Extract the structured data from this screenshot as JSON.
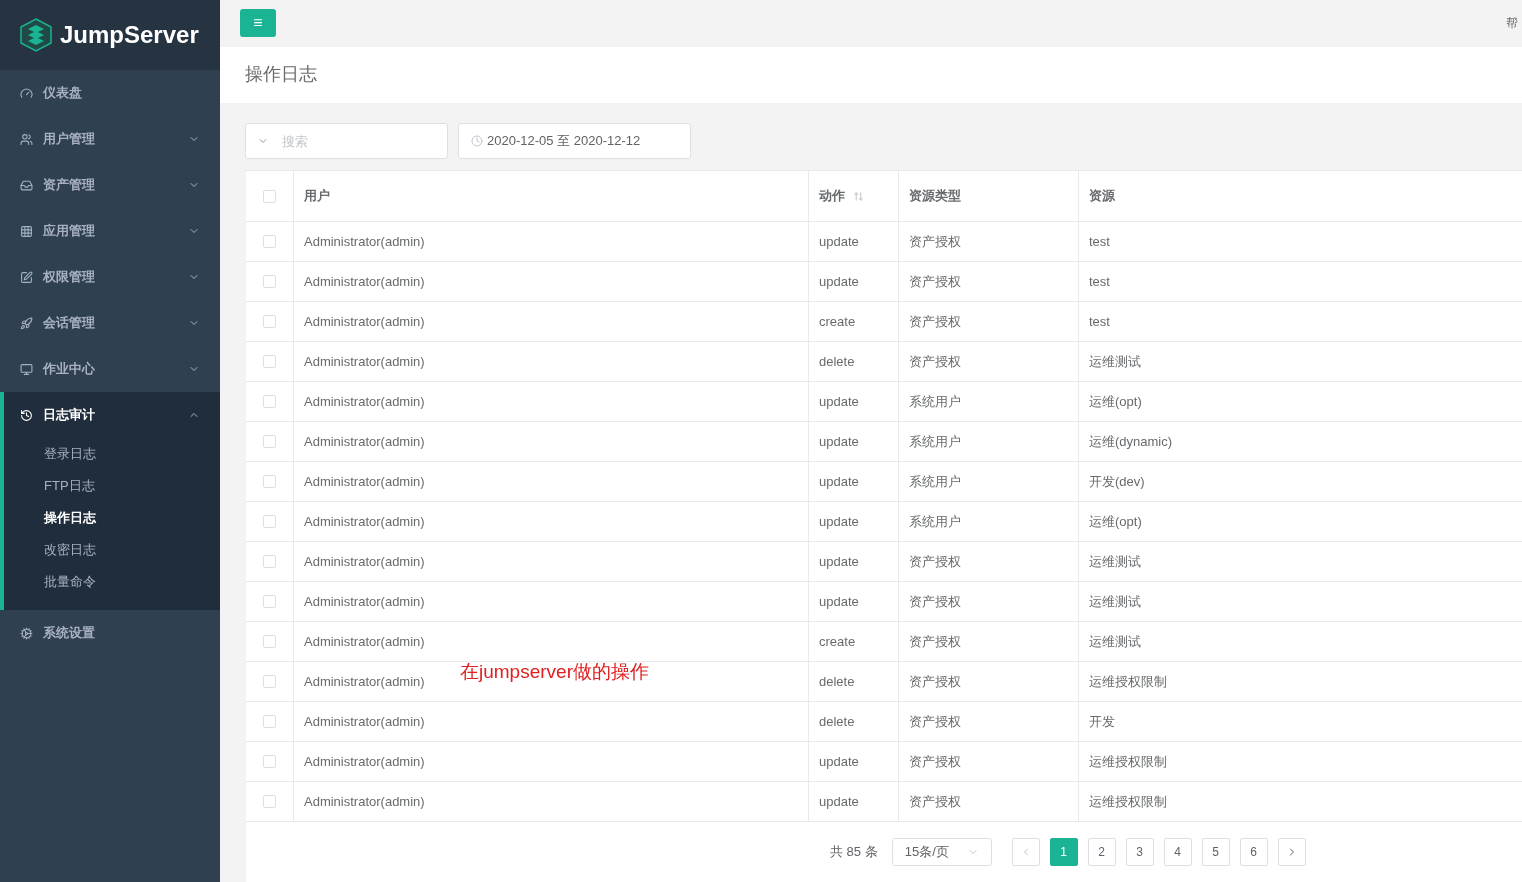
{
  "logo": {
    "text": "JumpServer"
  },
  "sidebar": {
    "items": [
      {
        "kind": "link",
        "label": "仪表盘"
      },
      {
        "kind": "group",
        "label": "用户管理",
        "expanded": false
      },
      {
        "kind": "group",
        "label": "资产管理",
        "expanded": false
      },
      {
        "kind": "group",
        "label": "应用管理",
        "expanded": false
      },
      {
        "kind": "group",
        "label": "权限管理",
        "expanded": false
      },
      {
        "kind": "group",
        "label": "会话管理",
        "expanded": false
      },
      {
        "kind": "group",
        "label": "作业中心",
        "expanded": false
      },
      {
        "kind": "group",
        "label": "日志审计",
        "expanded": true,
        "children": [
          {
            "label": "登录日志",
            "selected": false
          },
          {
            "label": "FTP日志",
            "selected": false
          },
          {
            "label": "操作日志",
            "selected": true
          },
          {
            "label": "改密日志",
            "selected": false
          },
          {
            "label": "批量命令",
            "selected": false
          }
        ]
      },
      {
        "kind": "link",
        "label": "系统设置"
      }
    ]
  },
  "topbar": {
    "menu_button": "≡",
    "help": "帮"
  },
  "page_title": "操作日志",
  "filters": {
    "search": {
      "placeholder": "搜索"
    },
    "date_range": {
      "start": "2020-12-05",
      "separator": "至",
      "end": "2020-12-12"
    }
  },
  "table": {
    "header_checked": false,
    "columns": [
      {
        "label": "用户",
        "sortable": false
      },
      {
        "label": "动作",
        "sortable": true
      },
      {
        "label": "资源类型",
        "sortable": false
      },
      {
        "label": "资源",
        "sortable": false
      }
    ],
    "rows": [
      {
        "checked": false,
        "cells": [
          "Administrator(admin)",
          "update",
          "资产授权",
          "test"
        ]
      },
      {
        "checked": false,
        "cells": [
          "Administrator(admin)",
          "update",
          "资产授权",
          "test"
        ]
      },
      {
        "checked": false,
        "cells": [
          "Administrator(admin)",
          "create",
          "资产授权",
          "test"
        ]
      },
      {
        "checked": false,
        "cells": [
          "Administrator(admin)",
          "delete",
          "资产授权",
          "运维测试"
        ]
      },
      {
        "checked": false,
        "cells": [
          "Administrator(admin)",
          "update",
          "系统用户",
          "运维(opt)"
        ]
      },
      {
        "checked": false,
        "cells": [
          "Administrator(admin)",
          "update",
          "系统用户",
          "运维(dynamic)"
        ]
      },
      {
        "checked": false,
        "cells": [
          "Administrator(admin)",
          "update",
          "系统用户",
          "开发(dev)"
        ]
      },
      {
        "checked": false,
        "cells": [
          "Administrator(admin)",
          "update",
          "系统用户",
          "运维(opt)"
        ]
      },
      {
        "checked": false,
        "cells": [
          "Administrator(admin)",
          "update",
          "资产授权",
          "运维测试"
        ]
      },
      {
        "checked": false,
        "cells": [
          "Administrator(admin)",
          "update",
          "资产授权",
          "运维测试"
        ]
      },
      {
        "checked": false,
        "cells": [
          "Administrator(admin)",
          "create",
          "资产授权",
          "运维测试"
        ]
      },
      {
        "checked": false,
        "cells": [
          "Administrator(admin)",
          "delete",
          "资产授权",
          "运维授权限制"
        ]
      },
      {
        "checked": false,
        "cells": [
          "Administrator(admin)",
          "delete",
          "资产授权",
          "开发"
        ]
      },
      {
        "checked": false,
        "cells": [
          "Administrator(admin)",
          "update",
          "资产授权",
          "运维授权限制"
        ]
      },
      {
        "checked": false,
        "cells": [
          "Administrator(admin)",
          "update",
          "资产授权",
          "运维授权限制"
        ]
      }
    ]
  },
  "pagination": {
    "total": "共 85 条",
    "page_size": "15条/页",
    "pages": [
      {
        "label": "1",
        "selected": true
      },
      {
        "label": "2",
        "selected": false
      },
      {
        "label": "3",
        "selected": false
      },
      {
        "label": "4",
        "selected": false
      },
      {
        "label": "5",
        "selected": false
      },
      {
        "label": "6",
        "selected": false
      }
    ]
  },
  "annotation": "在jumpserver做的操作"
}
